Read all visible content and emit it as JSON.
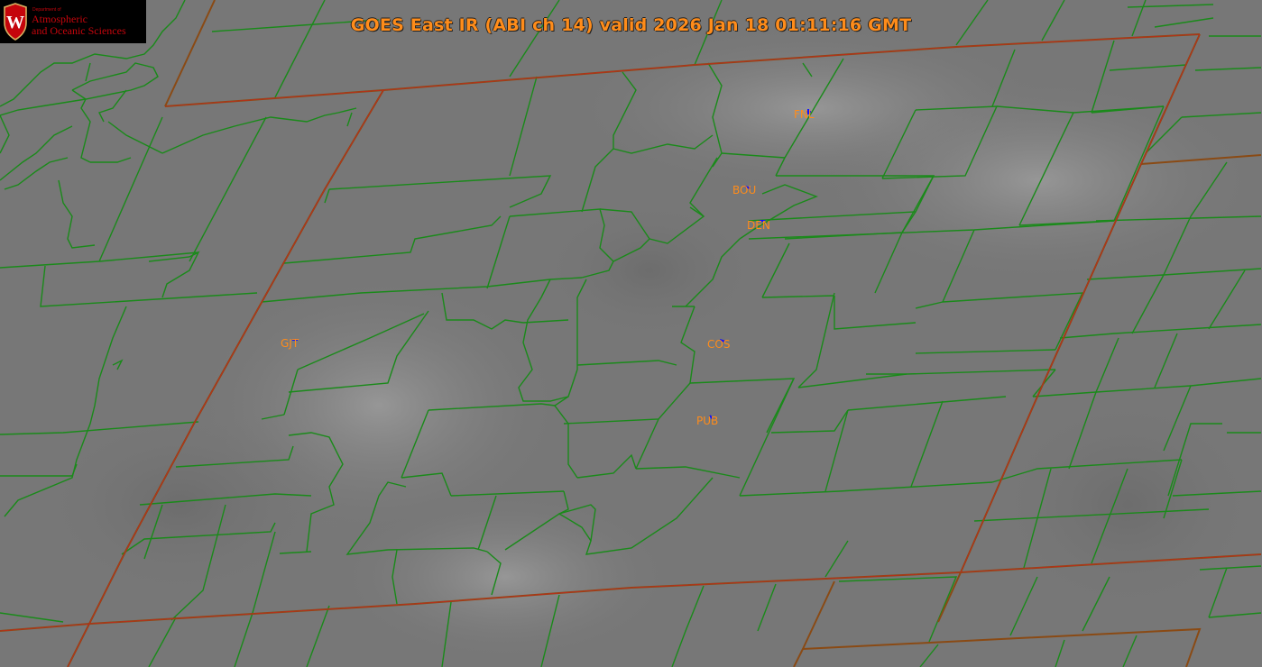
{
  "title": "GOES East IR (ABI ch 14) valid 2026 Jan 18 01:11:16 GMT",
  "logo": {
    "department": "Department of",
    "line1": "Atmospheric",
    "line2": "and Oceanic Sciences",
    "crest_letter": "W"
  },
  "colors": {
    "background_ir": "#7a7a7a",
    "county_line": "#1a8a1a",
    "state_line": "#8a4a14",
    "label": "#ff8c1a",
    "station_marker": "#1010ff"
  },
  "stations": [
    {
      "id": "FNL",
      "label": "FNL"
    },
    {
      "id": "BOU",
      "label": "BOU"
    },
    {
      "id": "DEN",
      "label": "DEN"
    },
    {
      "id": "GJT",
      "label": "GJT"
    },
    {
      "id": "COS",
      "label": "COS"
    },
    {
      "id": "PUB",
      "label": "PUB"
    }
  ]
}
